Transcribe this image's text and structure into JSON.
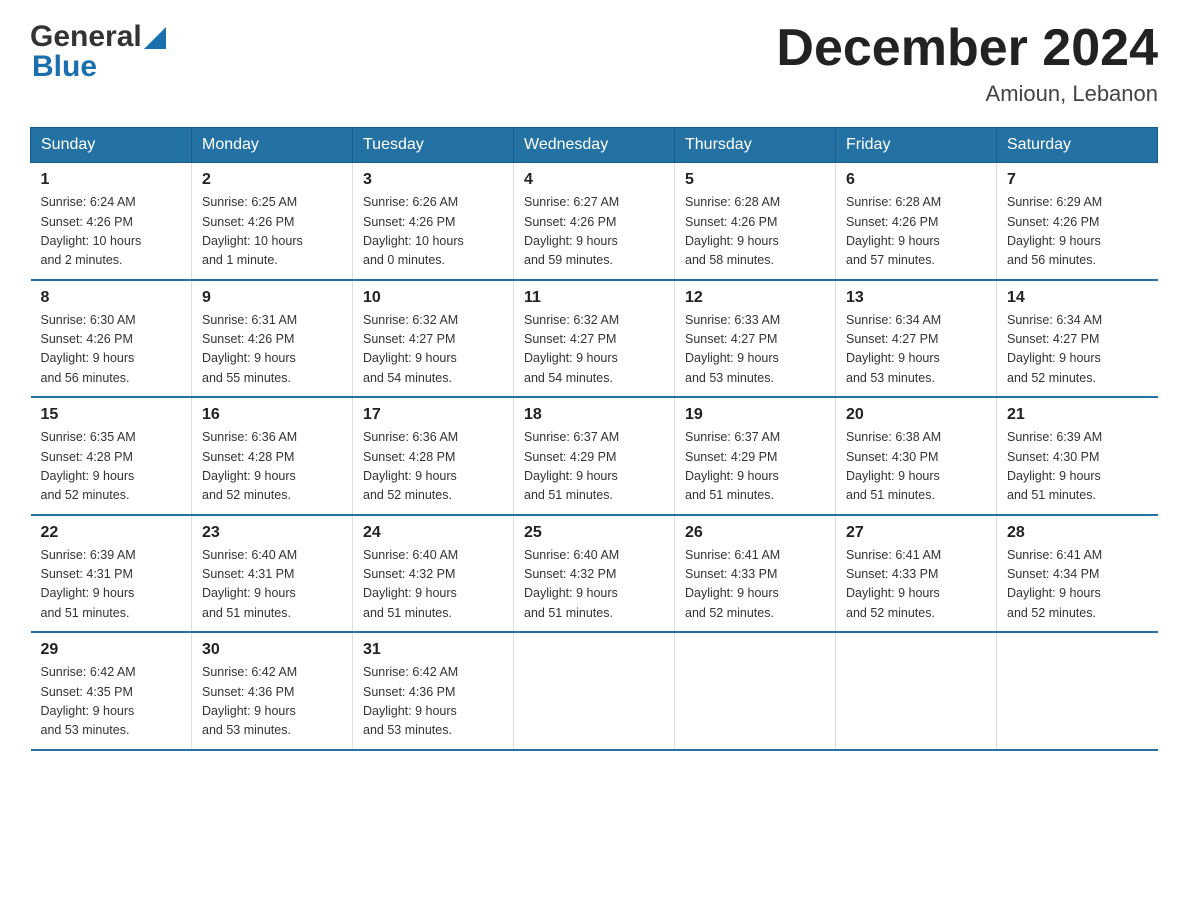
{
  "logo": {
    "text_general": "General",
    "text_blue": "Blue",
    "triangle_color": "#1a6faf"
  },
  "header": {
    "month_title": "December 2024",
    "location": "Amioun, Lebanon"
  },
  "weekdays": [
    "Sunday",
    "Monday",
    "Tuesday",
    "Wednesday",
    "Thursday",
    "Friday",
    "Saturday"
  ],
  "rows": [
    [
      {
        "day": "1",
        "sunrise": "6:24 AM",
        "sunset": "4:26 PM",
        "daylight": "10 hours and 2 minutes."
      },
      {
        "day": "2",
        "sunrise": "6:25 AM",
        "sunset": "4:26 PM",
        "daylight": "10 hours and 1 minute."
      },
      {
        "day": "3",
        "sunrise": "6:26 AM",
        "sunset": "4:26 PM",
        "daylight": "10 hours and 0 minutes."
      },
      {
        "day": "4",
        "sunrise": "6:27 AM",
        "sunset": "4:26 PM",
        "daylight": "9 hours and 59 minutes."
      },
      {
        "day": "5",
        "sunrise": "6:28 AM",
        "sunset": "4:26 PM",
        "daylight": "9 hours and 58 minutes."
      },
      {
        "day": "6",
        "sunrise": "6:28 AM",
        "sunset": "4:26 PM",
        "daylight": "9 hours and 57 minutes."
      },
      {
        "day": "7",
        "sunrise": "6:29 AM",
        "sunset": "4:26 PM",
        "daylight": "9 hours and 56 minutes."
      }
    ],
    [
      {
        "day": "8",
        "sunrise": "6:30 AM",
        "sunset": "4:26 PM",
        "daylight": "9 hours and 56 minutes."
      },
      {
        "day": "9",
        "sunrise": "6:31 AM",
        "sunset": "4:26 PM",
        "daylight": "9 hours and 55 minutes."
      },
      {
        "day": "10",
        "sunrise": "6:32 AM",
        "sunset": "4:27 PM",
        "daylight": "9 hours and 54 minutes."
      },
      {
        "day": "11",
        "sunrise": "6:32 AM",
        "sunset": "4:27 PM",
        "daylight": "9 hours and 54 minutes."
      },
      {
        "day": "12",
        "sunrise": "6:33 AM",
        "sunset": "4:27 PM",
        "daylight": "9 hours and 53 minutes."
      },
      {
        "day": "13",
        "sunrise": "6:34 AM",
        "sunset": "4:27 PM",
        "daylight": "9 hours and 53 minutes."
      },
      {
        "day": "14",
        "sunrise": "6:34 AM",
        "sunset": "4:27 PM",
        "daylight": "9 hours and 52 minutes."
      }
    ],
    [
      {
        "day": "15",
        "sunrise": "6:35 AM",
        "sunset": "4:28 PM",
        "daylight": "9 hours and 52 minutes."
      },
      {
        "day": "16",
        "sunrise": "6:36 AM",
        "sunset": "4:28 PM",
        "daylight": "9 hours and 52 minutes."
      },
      {
        "day": "17",
        "sunrise": "6:36 AM",
        "sunset": "4:28 PM",
        "daylight": "9 hours and 52 minutes."
      },
      {
        "day": "18",
        "sunrise": "6:37 AM",
        "sunset": "4:29 PM",
        "daylight": "9 hours and 51 minutes."
      },
      {
        "day": "19",
        "sunrise": "6:37 AM",
        "sunset": "4:29 PM",
        "daylight": "9 hours and 51 minutes."
      },
      {
        "day": "20",
        "sunrise": "6:38 AM",
        "sunset": "4:30 PM",
        "daylight": "9 hours and 51 minutes."
      },
      {
        "day": "21",
        "sunrise": "6:39 AM",
        "sunset": "4:30 PM",
        "daylight": "9 hours and 51 minutes."
      }
    ],
    [
      {
        "day": "22",
        "sunrise": "6:39 AM",
        "sunset": "4:31 PM",
        "daylight": "9 hours and 51 minutes."
      },
      {
        "day": "23",
        "sunrise": "6:40 AM",
        "sunset": "4:31 PM",
        "daylight": "9 hours and 51 minutes."
      },
      {
        "day": "24",
        "sunrise": "6:40 AM",
        "sunset": "4:32 PM",
        "daylight": "9 hours and 51 minutes."
      },
      {
        "day": "25",
        "sunrise": "6:40 AM",
        "sunset": "4:32 PM",
        "daylight": "9 hours and 51 minutes."
      },
      {
        "day": "26",
        "sunrise": "6:41 AM",
        "sunset": "4:33 PM",
        "daylight": "9 hours and 52 minutes."
      },
      {
        "day": "27",
        "sunrise": "6:41 AM",
        "sunset": "4:33 PM",
        "daylight": "9 hours and 52 minutes."
      },
      {
        "day": "28",
        "sunrise": "6:41 AM",
        "sunset": "4:34 PM",
        "daylight": "9 hours and 52 minutes."
      }
    ],
    [
      {
        "day": "29",
        "sunrise": "6:42 AM",
        "sunset": "4:35 PM",
        "daylight": "9 hours and 53 minutes."
      },
      {
        "day": "30",
        "sunrise": "6:42 AM",
        "sunset": "4:36 PM",
        "daylight": "9 hours and 53 minutes."
      },
      {
        "day": "31",
        "sunrise": "6:42 AM",
        "sunset": "4:36 PM",
        "daylight": "9 hours and 53 minutes."
      },
      null,
      null,
      null,
      null
    ]
  ],
  "labels": {
    "sunrise": "Sunrise:",
    "sunset": "Sunset:",
    "daylight": "Daylight:"
  }
}
